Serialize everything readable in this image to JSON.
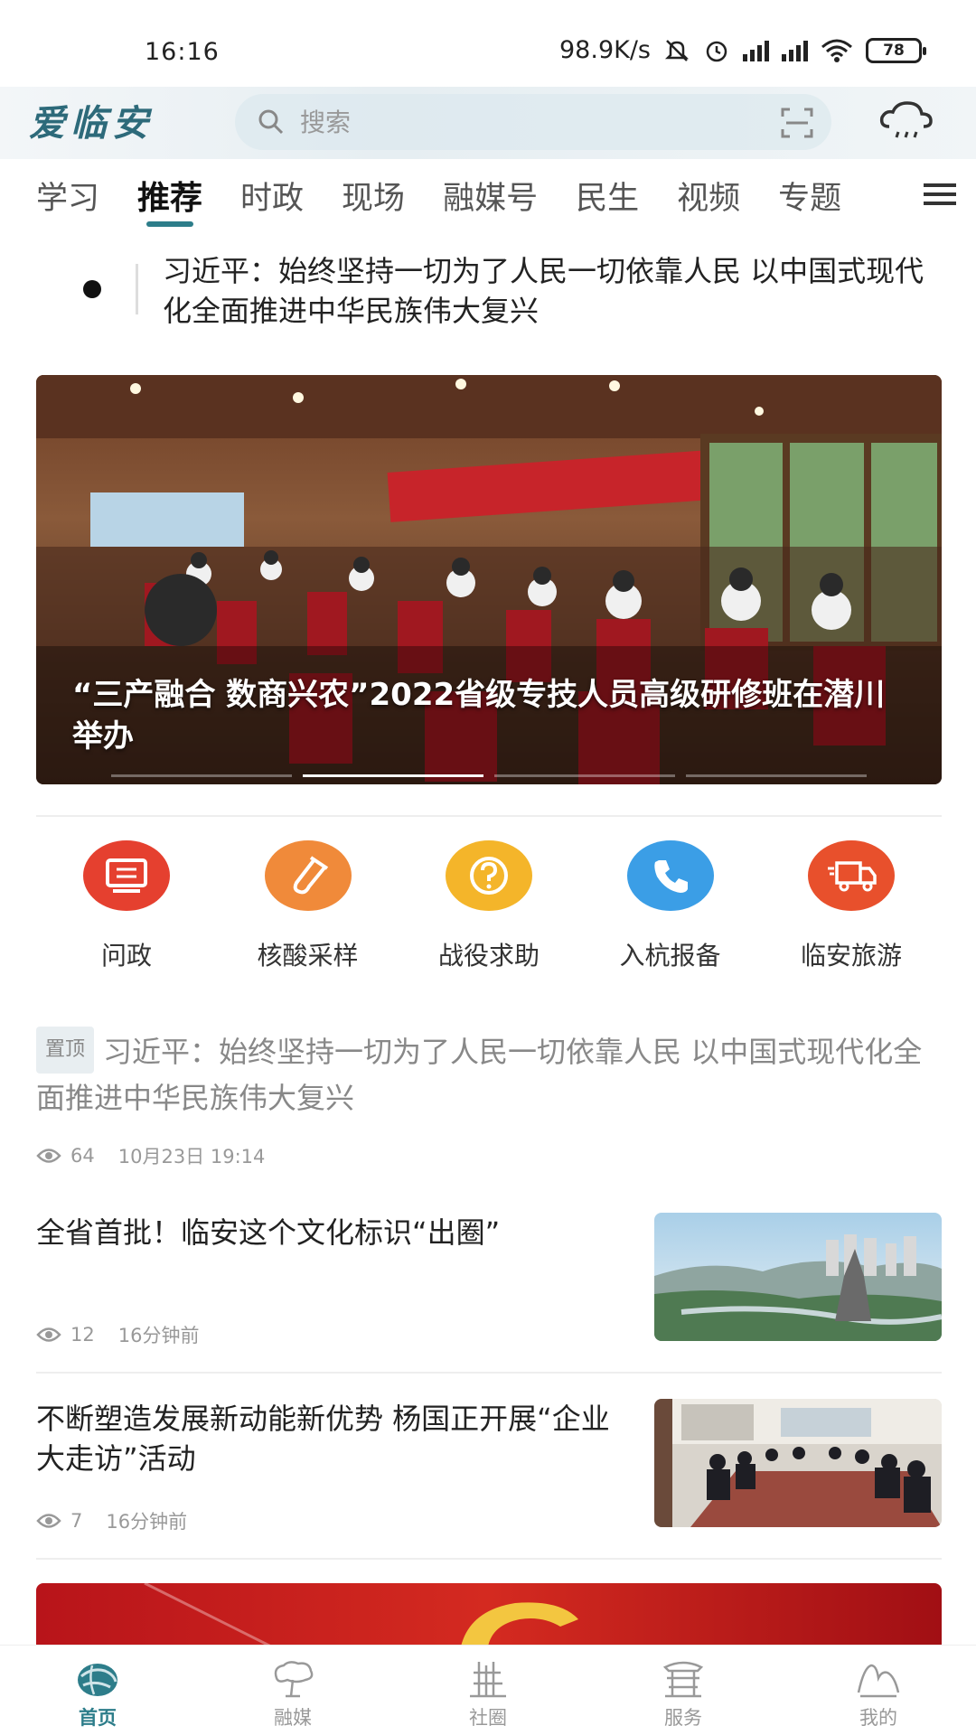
{
  "status_bar": {
    "time": "16:16",
    "net_speed": "98.9K/s",
    "battery": "78"
  },
  "header": {
    "logo": "爱临安",
    "search_placeholder": "搜索"
  },
  "tabs": [
    {
      "label": "学习"
    },
    {
      "label": "推荐",
      "active": true
    },
    {
      "label": "时政"
    },
    {
      "label": "现场"
    },
    {
      "label": "融媒号"
    },
    {
      "label": "民生"
    },
    {
      "label": "视频"
    },
    {
      "label": "专题"
    }
  ],
  "ticker": {
    "text": "习近平：始终坚持一切为了人民一切依靠人民 以中国式现代化全面推进中华民族伟大复兴"
  },
  "banner": {
    "caption": "“三产融合 数商兴农”2022省级专技人员高级研修班在潜川举办",
    "slide_count": 4,
    "active_slide": 2
  },
  "services": [
    {
      "label": "问政",
      "icon": "monitor-icon",
      "color": "#e5402f"
    },
    {
      "label": "核酸采样",
      "icon": "test-tube-icon",
      "color": "#f08a3a"
    },
    {
      "label": "战役求助",
      "icon": "question-icon",
      "color": "#f4b52a"
    },
    {
      "label": "入杭报备",
      "icon": "phone-icon",
      "color": "#3b9ee6"
    },
    {
      "label": "临安旅游",
      "icon": "truck-icon",
      "color": "#e8502c"
    }
  ],
  "pinned": {
    "badge": "置顶",
    "title": "习近平：始终坚持一切为了人民一切依靠人民 以中国式现代化全面推进中华民族伟大复兴",
    "views": "64",
    "time": "10月23日 19:14"
  },
  "news": [
    {
      "title": "全省首批！临安这个文化标识“出圈”",
      "views": "12",
      "time": "16分钟前"
    },
    {
      "title": "不断塑造发展新动能新优势 杨国正开展“企业大走访”活动",
      "views": "7",
      "time": "16分钟前"
    }
  ],
  "bottom_nav": [
    {
      "label": "首页",
      "icon": "home-globe-icon",
      "active": true
    },
    {
      "label": "融媒",
      "icon": "media-tree-icon"
    },
    {
      "label": "社圈",
      "icon": "community-tower-icon"
    },
    {
      "label": "服务",
      "icon": "service-pavilion-icon"
    },
    {
      "label": "我的",
      "icon": "mine-mountain-icon"
    }
  ],
  "colors": {
    "accent": "#2d7d8a",
    "pinned_text": "#888888"
  }
}
